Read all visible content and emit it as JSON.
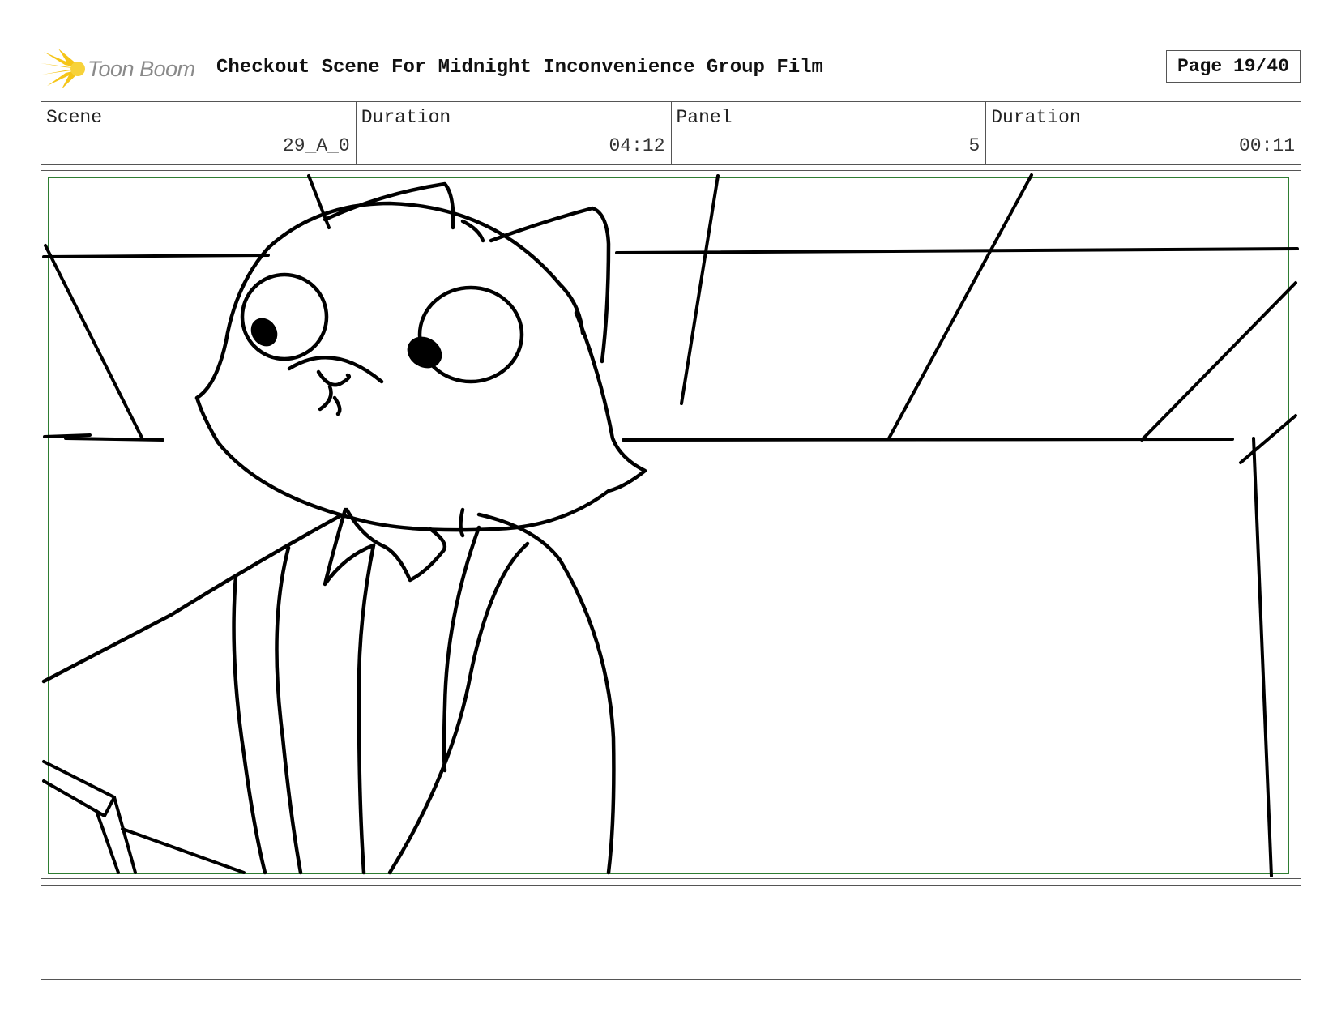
{
  "header": {
    "logo_text": "Toon Boom",
    "title": "Checkout Scene For Midnight Inconvenience Group Film",
    "page_label": "Page 19/40"
  },
  "info": {
    "scene_label": "Scene",
    "scene_value": "29_A_0",
    "scene_duration_label": "Duration",
    "scene_duration_value": "04:12",
    "panel_label": "Panel",
    "panel_value": "5",
    "panel_duration_label": "Duration",
    "panel_duration_value": "00:11"
  },
  "colors": {
    "frame_border": "#555555",
    "safe_area": "#2e7d32",
    "logo_yellow": "#f5c518",
    "ink": "#000000"
  },
  "icons": {
    "logo": "toon-boom-burst-icon"
  },
  "notes": {
    "text": ""
  }
}
